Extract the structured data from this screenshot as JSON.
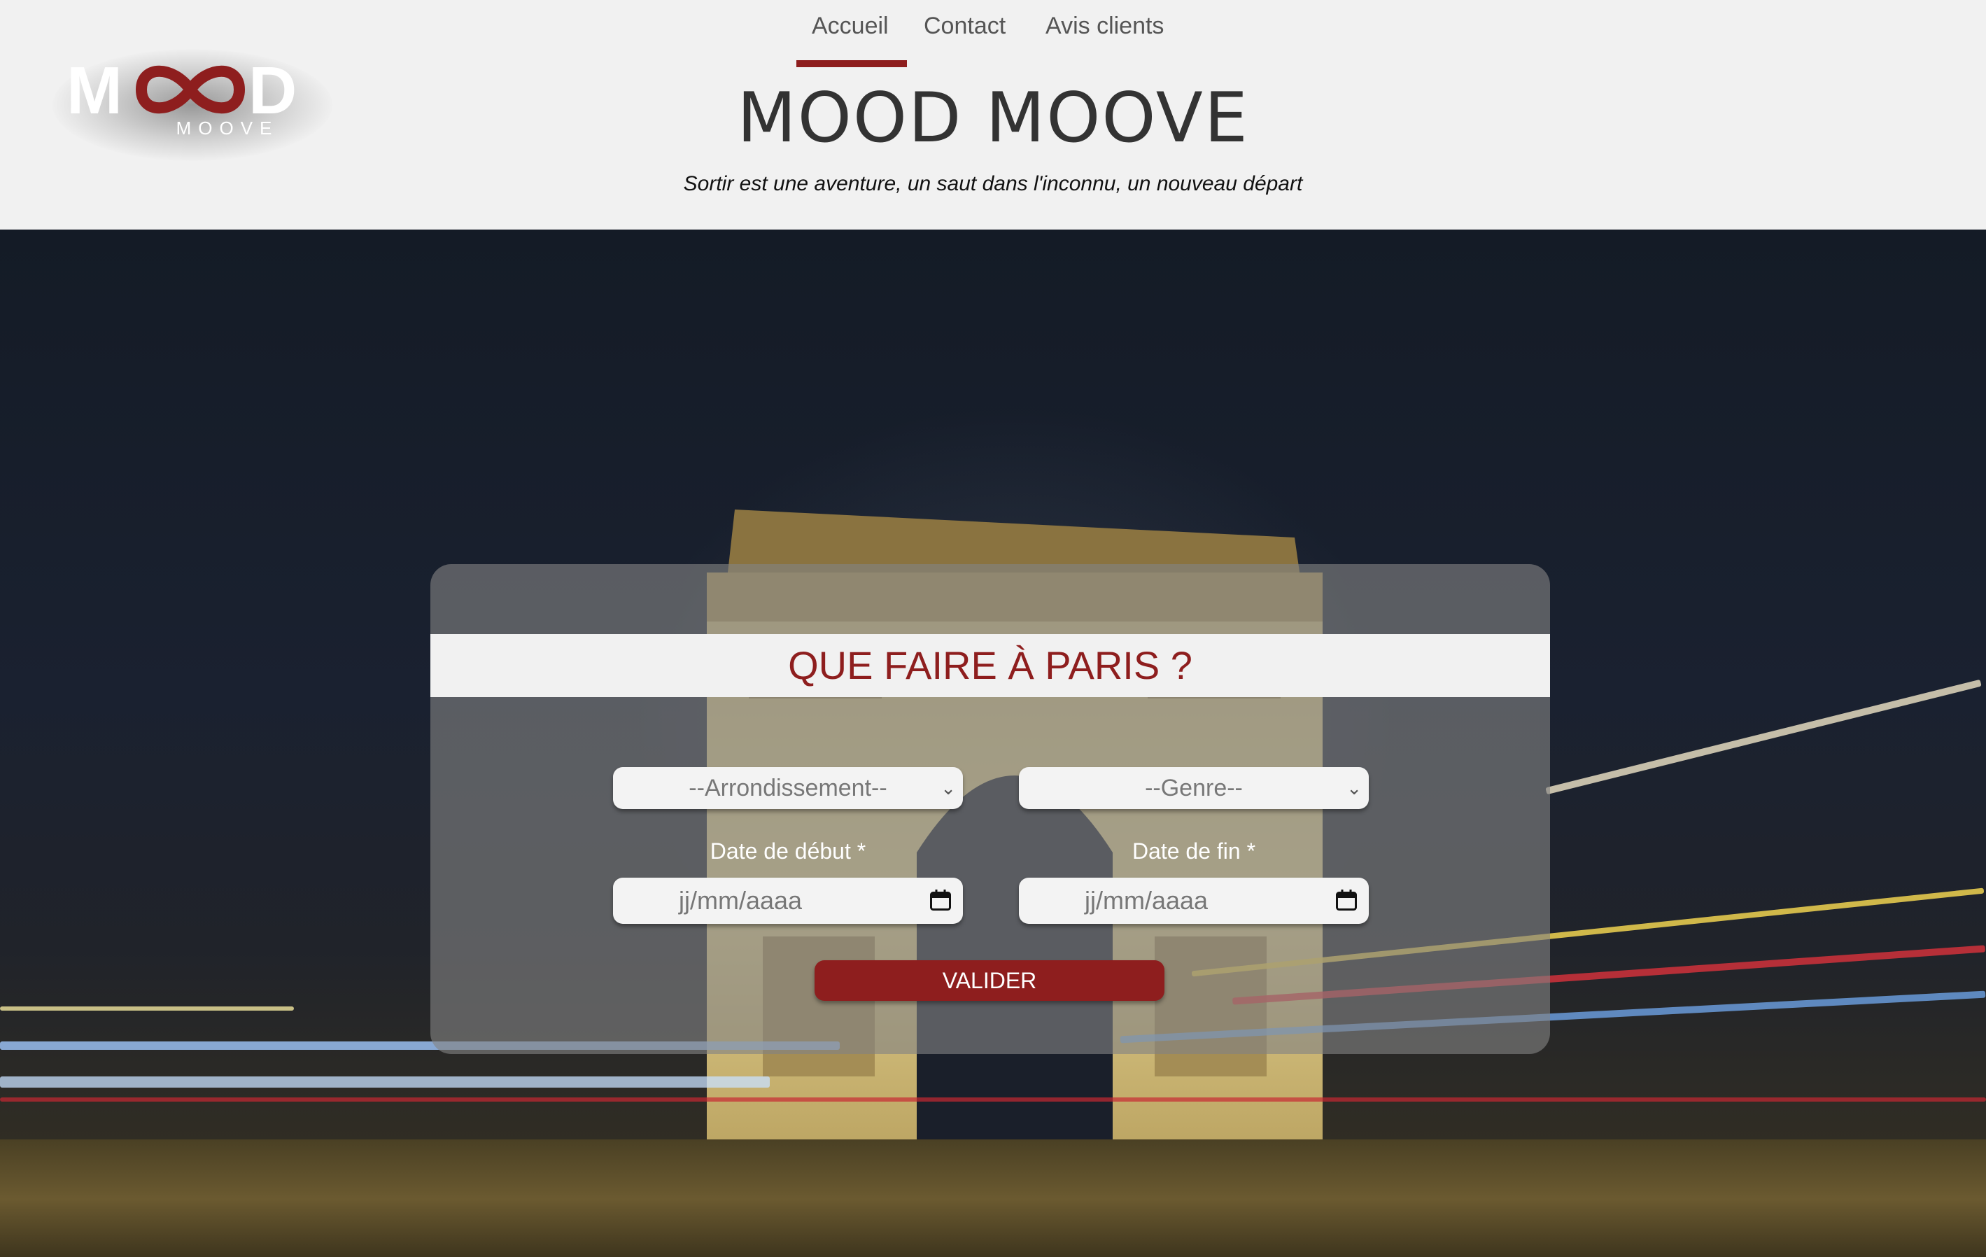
{
  "header": {
    "logo": {
      "main_text": "MOOD",
      "sub_text": "MOOVE"
    },
    "nav": [
      {
        "label": "Accueil",
        "active": true
      },
      {
        "label": "Contact",
        "active": false
      },
      {
        "label": "Avis clients",
        "active": false
      }
    ],
    "title": "MOOD MOOVE",
    "tagline": "Sortir est une aventure, un saut dans l'inconnu, un nouveau départ"
  },
  "hero": {
    "background_subject": "Arc de Triomphe at night with light trails"
  },
  "form": {
    "title": "QUE FAIRE À PARIS ?",
    "arrondissement": {
      "selected": "--Arrondissement--"
    },
    "genre": {
      "selected": "--Genre--"
    },
    "start_date": {
      "label": "Date de début *",
      "placeholder": "jj/mm/aaaa"
    },
    "end_date": {
      "label": "Date de fin *",
      "placeholder": "jj/mm/aaaa"
    },
    "submit_label": "VALIDER"
  },
  "colors": {
    "accent": "#8e1e1e",
    "header_bg": "#f1f1f1",
    "title_text": "#333333"
  },
  "icons": {
    "select": "chevron-down-icon",
    "date": "calendar-icon"
  }
}
